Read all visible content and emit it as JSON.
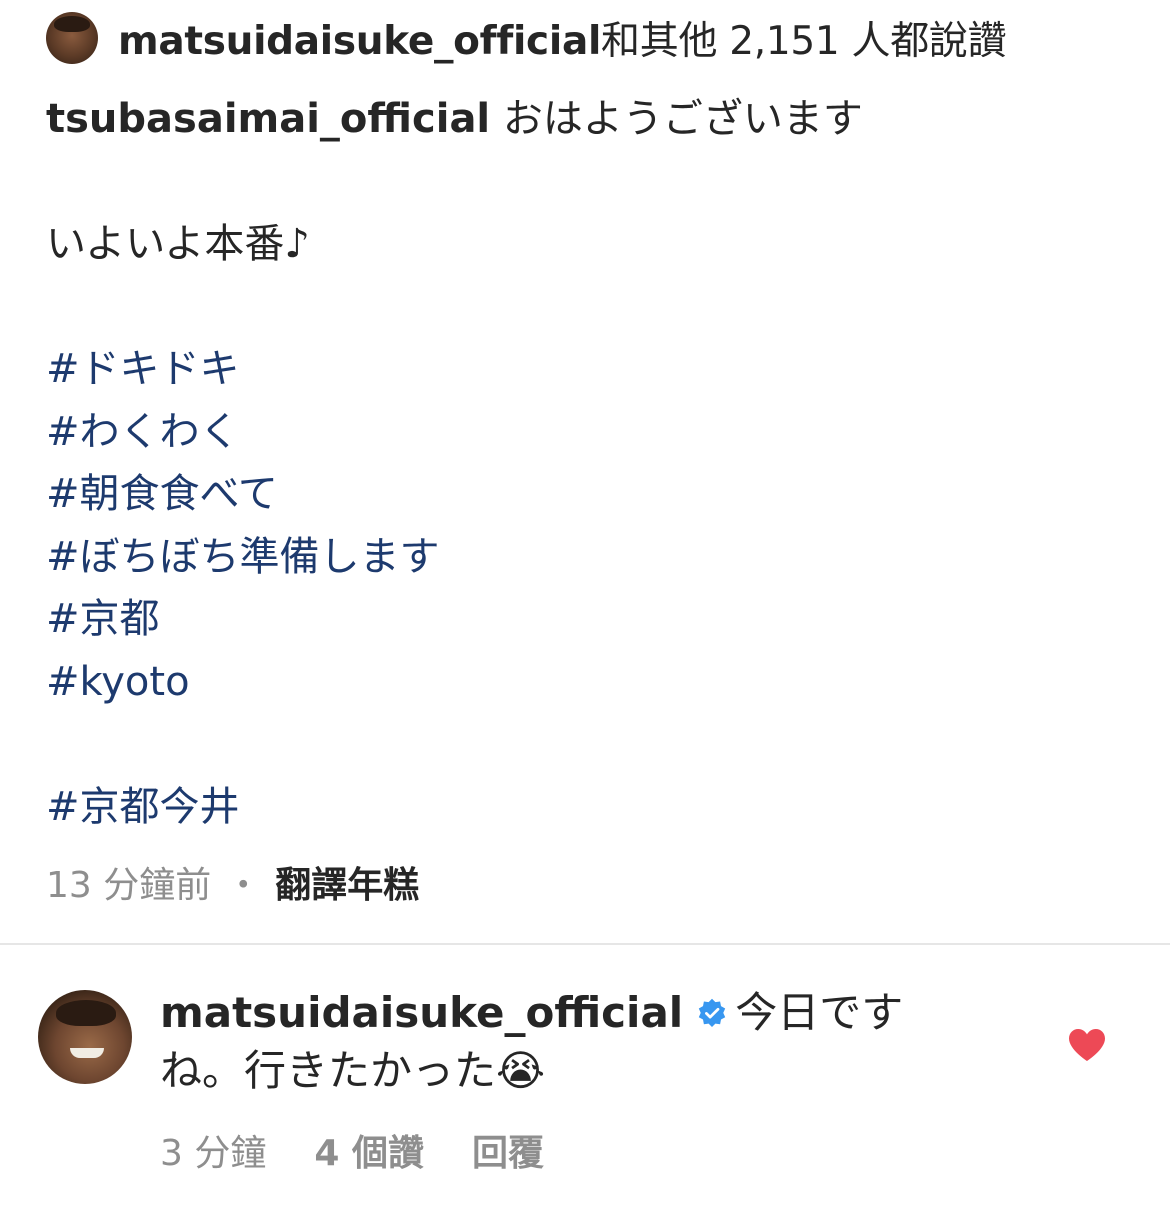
{
  "likes": {
    "user": "matsuidaisuke_official",
    "suffix": "和其他 2,151 人都說讚"
  },
  "caption": {
    "user": "tsubasaimai_official",
    "line1": "おはようございます",
    "line2": "いよいよ本番♪",
    "hashtags": [
      "#ドキドキ",
      "#わくわく",
      "#朝食食べて",
      "#ぼちぼち準備します",
      "#京都",
      "#kyoto"
    ],
    "hashtag_last": "#京都今井"
  },
  "meta": {
    "time": "13 分鐘前",
    "separator": "・",
    "translate": "翻譯年糕"
  },
  "comment": {
    "user": "matsuidaisuke_official",
    "text": "今日ですね。行きたかった😭",
    "time": "3 分鐘",
    "likes": "4 個讚",
    "reply": "回覆",
    "heart_color": "#ed4956",
    "verified_color": "#3897f0"
  }
}
